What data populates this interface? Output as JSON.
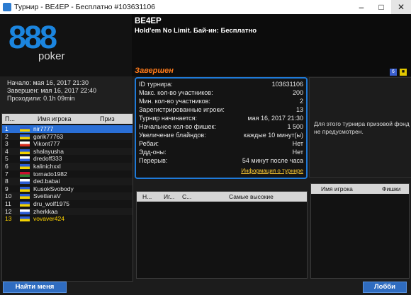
{
  "window": {
    "title": "Турнир - BE4EP - Бесплатно #103631106",
    "minimize": "–",
    "maximize": "□",
    "close": "✕"
  },
  "logo": {
    "brand": "888",
    "sub": "poker"
  },
  "header": {
    "name": "BE4EP",
    "game": "Hold'em No Limit. Бай-ин: Бесплатно",
    "status": "Завершен",
    "badge": "6",
    "lock": "🔒"
  },
  "times": {
    "start": "Начало: мая 16, 2017 21:30",
    "end": "Завершен: мая 16, 2017 22:40",
    "elapsed": "Проходили: 0.1h 09min"
  },
  "players_table": {
    "headers": [
      "П...",
      "Имя игрока",
      "Приз"
    ],
    "rows": [
      {
        "num": "1",
        "name": "nir7777",
        "flag": [
          "#2b5bd3",
          "#f2d200"
        ],
        "selected": true
      },
      {
        "num": "2",
        "name": "garik77763",
        "flag": [
          "#2b5bd3",
          "#f2d200"
        ]
      },
      {
        "num": "3",
        "name": "Vikont777",
        "flag": [
          "#ffffff",
          "#d52b1e"
        ]
      },
      {
        "num": "4",
        "name": "shalayusha",
        "flag": [
          "#2b5bd3",
          "#f2d200"
        ]
      },
      {
        "num": "5",
        "name": "dredoff333",
        "flag": [
          "#ffffff",
          "#2b5bd3"
        ]
      },
      {
        "num": "6",
        "name": "kalinichxxl",
        "flag": [
          "#2b5bd3",
          "#f2d200"
        ]
      },
      {
        "num": "7",
        "name": "tornado1982",
        "flag": [
          "#c8102e",
          "#2e7d32"
        ]
      },
      {
        "num": "8",
        "name": "ded.babai",
        "flag": [
          "#ffffff",
          "#2b5bd3"
        ]
      },
      {
        "num": "9",
        "name": "KusokSvobody",
        "flag": [
          "#2b5bd3",
          "#f2d200"
        ]
      },
      {
        "num": "10",
        "name": "SvetlanaV",
        "flag": [
          "#2b5bd3",
          "#f2d200"
        ]
      },
      {
        "num": "11",
        "name": "dru_wolf1975",
        "flag": [
          "#2b5bd3",
          "#f2d200"
        ]
      },
      {
        "num": "12",
        "name": "zherkkaa",
        "flag": [
          "#ffffff",
          "#2b5bd3"
        ]
      },
      {
        "num": "13",
        "name": "vovaver424",
        "flag": [
          "#2b5bd3",
          "#f2d200"
        ],
        "highlight": true
      }
    ]
  },
  "info": {
    "rows": [
      {
        "label": "ID турнира:",
        "value": "103631106"
      },
      {
        "label": "Макс. кол-во участников:",
        "value": "200"
      },
      {
        "label": "Мин. кол-во участников:",
        "value": "2"
      },
      {
        "label": "Зарегистрированные игроки:",
        "value": "13"
      },
      {
        "label": "Турнир начинается:",
        "value": "мая 16, 2017 21:30"
      },
      {
        "label": "Начальное кол-во фишек:",
        "value": "1 500"
      },
      {
        "label": "Увеличение блайндов:",
        "value": "каждые 10 минут(ы)"
      },
      {
        "label": "Ребаи:",
        "value": "Нет"
      },
      {
        "label": "Эдд-оны:",
        "value": "Нет"
      },
      {
        "label": "Перерыв:",
        "value": "54 минут после часа"
      }
    ],
    "link": "Информация о турнире"
  },
  "prize": {
    "text": "Для этого турнира призовой фонд не предусмотрен."
  },
  "tables": {
    "headers": [
      "Н...",
      "Иг...",
      "С...",
      "Самые высокие"
    ]
  },
  "table_players": {
    "headers": [
      "Имя игрока",
      "Фишки"
    ]
  },
  "buttons": {
    "find": "Найти меня",
    "lobby": "Лобби"
  },
  "colors": {
    "accent": "#1f7ad8",
    "status": "#ff7a1a",
    "link": "#ffcc33",
    "selected_row": "#2a6fd6",
    "highlight_name": "#ffd400"
  }
}
